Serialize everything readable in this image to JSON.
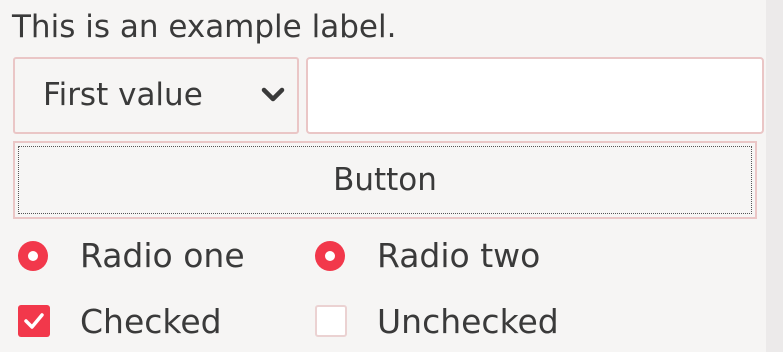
{
  "label": {
    "text": "This is an example label."
  },
  "combo": {
    "selected": "First value"
  },
  "entry": {
    "value": ""
  },
  "button": {
    "label": "Button"
  },
  "radios": [
    {
      "label": "Radio one",
      "checked": true
    },
    {
      "label": "Radio two",
      "checked": true
    }
  ],
  "checkboxes": [
    {
      "label": "Checked",
      "checked": true
    },
    {
      "label": "Unchecked",
      "checked": false
    }
  ],
  "colors": {
    "accent": "#f2384b",
    "background": "#f6f5f4",
    "border": "#eac6c6",
    "text": "#3a3a3a"
  },
  "icons": {
    "combo_arrow": "chevron-down-icon",
    "check_mark": "checkmark-icon"
  }
}
